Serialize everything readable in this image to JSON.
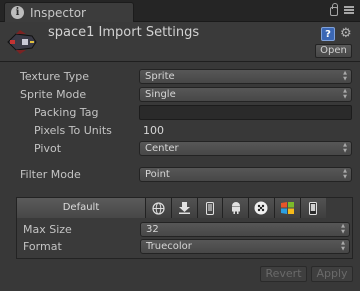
{
  "window": {
    "tab_title": "Inspector",
    "tab_icon": "info-icon",
    "tool_icons": [
      "lock-icon",
      "menu-icon"
    ]
  },
  "header": {
    "title": "space1 Import Settings",
    "help_icon": "help-icon",
    "help_glyph": "?",
    "settings_icon": "gear-icon",
    "open_label": "Open"
  },
  "fields": {
    "texture_type": {
      "label": "Texture Type",
      "value": "Sprite"
    },
    "sprite_mode": {
      "label": "Sprite Mode",
      "value": "Single"
    },
    "packing_tag": {
      "label": "Packing Tag",
      "value": ""
    },
    "pixels_to_units": {
      "label": "Pixels To Units",
      "value": "100"
    },
    "pivot": {
      "label": "Pivot",
      "value": "Center"
    },
    "filter_mode": {
      "label": "Filter Mode",
      "value": "Point"
    }
  },
  "platforms": {
    "default_label": "Default",
    "icons": [
      "globe-icon",
      "download-icon",
      "mobile-icon",
      "android-icon",
      "blackberry-icon",
      "windows-icon",
      "phone-icon"
    ],
    "max_size": {
      "label": "Max Size",
      "value": "32"
    },
    "format": {
      "label": "Format",
      "value": "Truecolor"
    }
  },
  "footer": {
    "revert_label": "Revert",
    "apply_label": "Apply"
  },
  "colors": {
    "panel_bg": "#383838",
    "help_blue": "#3b67b4"
  }
}
